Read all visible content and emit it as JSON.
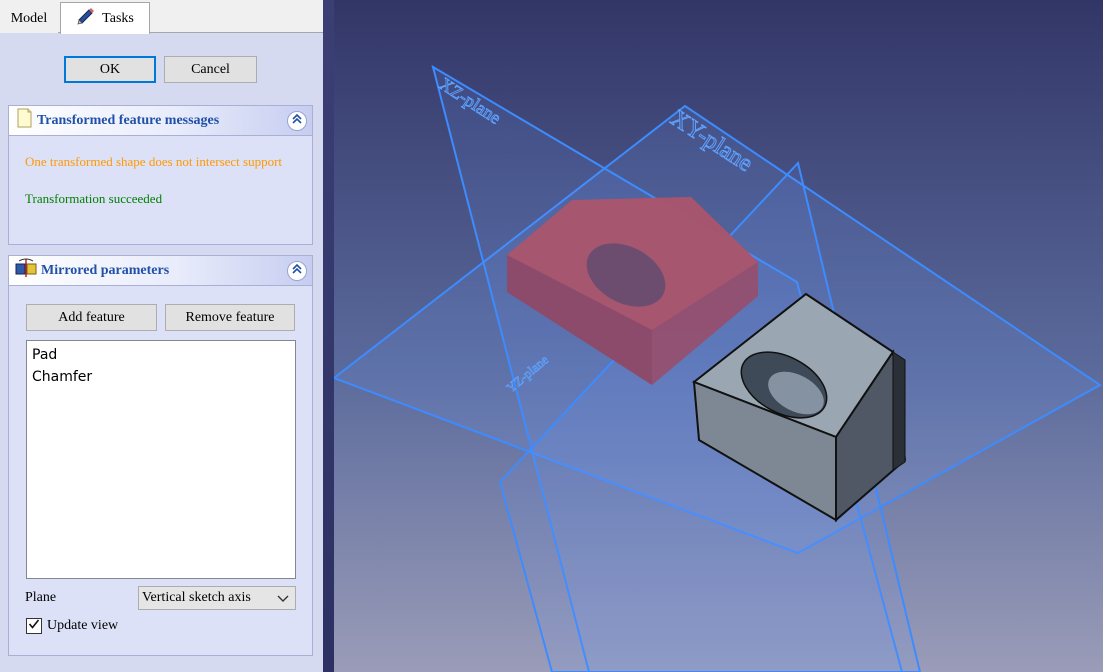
{
  "tabs": {
    "model_label": "Model",
    "tasks_label": "Tasks"
  },
  "dialog": {
    "ok_label": "OK",
    "cancel_label": "Cancel"
  },
  "messages_panel": {
    "title": "Transformed feature messages",
    "warning_text": "One transformed shape does not intersect support",
    "success_text": "Transformation succeeded",
    "warning_color": "#ff9900",
    "success_color": "#008000"
  },
  "mirrored_panel": {
    "title": "Mirrored parameters",
    "add_feature_label": "Add feature",
    "remove_feature_label": "Remove feature",
    "features": [
      "Pad",
      "Chamfer"
    ],
    "plane_label": "Plane",
    "plane_selected": "Vertical sketch axis",
    "update_view_label": "Update view",
    "update_view_checked": true
  },
  "viewport": {
    "plane_labels": {
      "xz": "XZ-plane",
      "xy": "XY-plane",
      "yz": "YZ-plane"
    },
    "plane_color": "#3d8cff",
    "mirrored_body_color": "#9b4b66",
    "solid_body_color": "#8e9aa7"
  }
}
